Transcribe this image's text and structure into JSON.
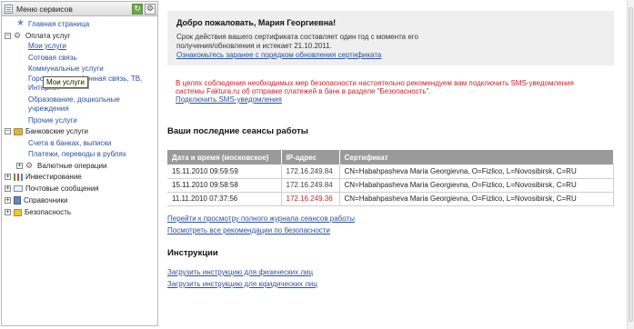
{
  "sidebar": {
    "title": "Меню сервисов",
    "refresh_icon": "refresh-icon",
    "settings_icon": "gear-icon",
    "tooltip": "Мои услуги",
    "items": {
      "home": "Главная страница",
      "payments": "Оплата услуг",
      "my_services": "Мои услуги",
      "cellular": "Сотовая связь",
      "utilities": "Коммунальные услуги",
      "phone": "Городская телефонная связь, ТВ, Интернет",
      "education": "Образование, дошкольные учреждения",
      "other": "Прочие услуги",
      "bank": "Банковские услуги",
      "accounts": "Счета в банках, выписки",
      "transfers": "Платежи, переводы в рублях",
      "currency": "Валютные операции",
      "investing": "Инвестирование",
      "mail": "Почтовые сообщения",
      "reference": "Справочники",
      "security": "Безопасность"
    }
  },
  "main": {
    "welcome_title": "Добро пожаловать, Мария Георгиевна!",
    "cert_text": "Срок действия вашего сертификата составляет один год с момента его получения/обновления и истекает 21.10.2011.",
    "cert_link": "Ознакомьтесь заранее с порядком обновления сертификата",
    "warning": "В целях соблюдения необходимых мер безопасности настоятельно рекомендуем вам подключить SMS-уведомления системы Faktura.ru об отправке платежей в банк в разделе \"Безопасность\".",
    "sms_link": "Подключить SMS-уведомления",
    "sessions_title": "Ваши последние сеансы работы",
    "table": {
      "headers": [
        "Дата и время (московское)",
        "IP-адрес",
        "Сертификат"
      ],
      "rows": [
        {
          "dt": "15.11.2010 09:59:59",
          "ip": "172.16.249.84",
          "cert": "CN=Habahpasheva Maria Georgievna, O=Fizlico, L=Novosibirsk, C=RU"
        },
        {
          "dt": "15.11.2010 09:58:58",
          "ip": "172.16.249.84",
          "cert": "CN=Habahpasheva Maria Georgievna, O=Fizlico, L=Novosibirsk, C=RU"
        },
        {
          "dt": "11.11.2010 07:37:56",
          "ip": "172.16.249.36",
          "cert": "CN=Habahpasheva Maria Georgievna, O=Fizlico, L=Novosibirsk, C=RU"
        }
      ]
    },
    "journal_link": "Перейти к просмотру полного журнала сеансов работы",
    "recommend_link": "Посмотреть все рекомендации по безопасности",
    "instructions_title": "Инструкции",
    "instr_phys": "Загрузить инструкцию для физических лиц",
    "instr_jur": "Загрузить инструкцию для юридических лиц"
  },
  "colors": {
    "link": "#2b4f9e",
    "warning": "#d0202a",
    "table_header": "#9a9a9a"
  }
}
